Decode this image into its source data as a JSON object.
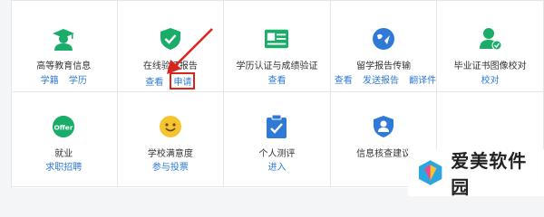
{
  "tiles": [
    {
      "title": "高等教育信息",
      "links": [
        "学籍",
        "学历"
      ],
      "icon": "graduate-icon"
    },
    {
      "title": "在线验证报告",
      "links": [
        "查看",
        "申请"
      ],
      "icon": "shield-check-icon"
    },
    {
      "title": "学历认证与成绩验证",
      "links": [
        "查看"
      ],
      "icon": "id-card-icon"
    },
    {
      "title": "留学报告传输",
      "links": [
        "查看",
        "发送报告",
        "翻译件"
      ],
      "icon": "globe-send-icon"
    },
    {
      "title": "毕业证书图像校对",
      "links": [
        "校对"
      ],
      "icon": "user-check-icon"
    },
    {
      "title": "就业",
      "links": [
        "求职招聘"
      ],
      "icon": "offer-icon",
      "badge": "Offer"
    },
    {
      "title": "学校满意度",
      "links": [
        "参与投票"
      ],
      "icon": "smile-icon"
    },
    {
      "title": "个人测评",
      "links": [
        "进入"
      ],
      "icon": "clipboard-check-icon"
    },
    {
      "title": "信息核查建议",
      "links": [],
      "icon": "user-shield-icon"
    }
  ],
  "watermark": {
    "text": "爱美软件园"
  },
  "colors": {
    "green": "#1aad6a",
    "blue": "#2f7ad6",
    "red": "#d9261c",
    "yellow": "#f7c431"
  }
}
